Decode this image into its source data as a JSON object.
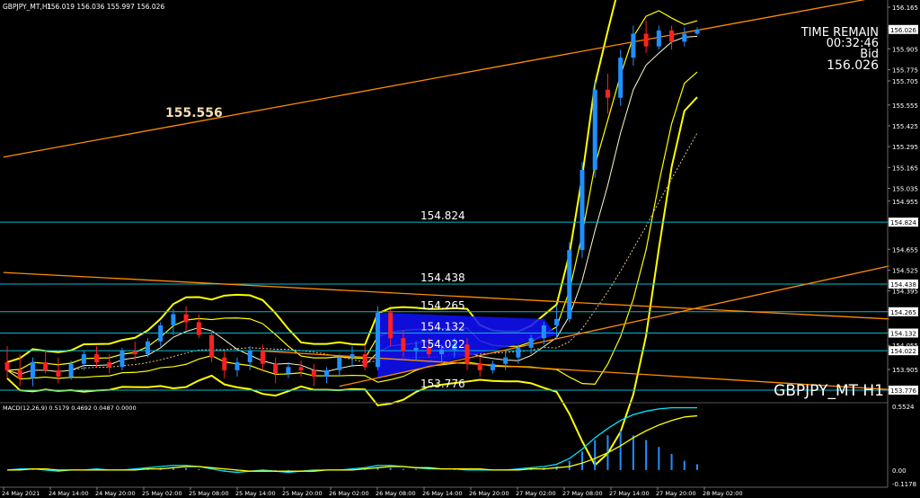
{
  "header": {
    "symbol_info": "GBPJPY_MT,H1",
    "ohlc": "156.019 156.036 155.997 156.026"
  },
  "overlay": {
    "time_remain_label": "TIME REMAIN",
    "time_remain_value": "00:32:46",
    "bid_label": "Bid",
    "bid_value": "156.026",
    "level_label": "155.556",
    "watermark": "GBPJPY_MT H1"
  },
  "macd": {
    "label": "MACD(12,26,9) 0.5179 0.4692 0.0487 0.0000",
    "scale": [
      "0.5524",
      "0.00",
      "-0.1178"
    ]
  },
  "colors": {
    "background": "#000000",
    "bull_candle": "#1e90ff",
    "bear_candle": "#ff2020",
    "bollinger": "#ffff00",
    "trendline": "#ff8c00",
    "hline": "#00bcd4",
    "price_tag_bg": "#00bcd4",
    "grid": "#202020"
  },
  "chart_data": {
    "type": "candlestick",
    "title": "GBPJPY_MT H1",
    "ylim": [
      153.776,
      156.2
    ],
    "yticks": [
      "156.165",
      "156.035",
      "155.905",
      "155.775",
      "155.705",
      "155.555",
      "155.425",
      "155.295",
      "155.165",
      "155.035",
      "154.955",
      "154.825",
      "154.655",
      "154.525",
      "154.395",
      "154.265",
      "154.135",
      "154.055",
      "153.905",
      "153.775"
    ],
    "xticks": [
      "24 May 2021",
      "24 May 14:00",
      "24 May 20:00",
      "25 May 02:00",
      "25 May 08:00",
      "25 May 14:00",
      "25 May 20:00",
      "26 May 02:00",
      "26 May 08:00",
      "26 May 14:00",
      "26 May 20:00",
      "27 May 02:00",
      "27 May 08:00",
      "27 May 14:00",
      "27 May 20:00",
      "28 May 02:00"
    ],
    "price_tags": [
      {
        "label": "156.026",
        "value": 156.026
      },
      {
        "label": "154.824",
        "value": 154.824
      },
      {
        "label": "154.438",
        "value": 154.438
      },
      {
        "label": "154.265",
        "value": 154.265
      },
      {
        "label": "154.132",
        "value": 154.132
      },
      {
        "label": "154.022",
        "value": 154.022
      },
      {
        "label": "153.776",
        "value": 153.776
      }
    ],
    "levels": [
      {
        "label": "154.824",
        "value": 154.824
      },
      {
        "label": "154.438",
        "value": 154.438
      },
      {
        "label": "154.265",
        "value": 154.265
      },
      {
        "label": "154.132",
        "value": 154.132
      },
      {
        "label": "154.022",
        "value": 154.022
      },
      {
        "label": "153.776",
        "value": 153.776
      }
    ],
    "candles": [
      [
        153.95,
        154.05,
        153.85,
        153.9
      ],
      [
        153.9,
        154.0,
        153.8,
        153.85
      ],
      [
        153.85,
        153.98,
        153.8,
        153.95
      ],
      [
        153.95,
        154.02,
        153.88,
        153.9
      ],
      [
        153.9,
        153.98,
        153.82,
        153.86
      ],
      [
        153.86,
        153.96,
        153.84,
        153.94
      ],
      [
        153.94,
        154.02,
        153.9,
        154.0
      ],
      [
        154.0,
        154.05,
        153.92,
        153.95
      ],
      [
        153.95,
        154.0,
        153.88,
        153.92
      ],
      [
        153.92,
        154.04,
        153.9,
        154.02
      ],
      [
        154.02,
        154.08,
        153.96,
        154.0
      ],
      [
        154.0,
        154.1,
        153.98,
        154.08
      ],
      [
        154.08,
        154.2,
        154.05,
        154.18
      ],
      [
        154.18,
        154.28,
        154.12,
        154.25
      ],
      [
        154.25,
        154.3,
        154.15,
        154.2
      ],
      [
        154.2,
        154.25,
        154.1,
        154.12
      ],
      [
        154.12,
        154.15,
        153.95,
        153.98
      ],
      [
        153.98,
        154.02,
        153.85,
        153.9
      ],
      [
        153.9,
        153.98,
        153.86,
        153.95
      ],
      [
        153.95,
        154.05,
        153.9,
        154.02
      ],
      [
        154.02,
        154.06,
        153.9,
        153.94
      ],
      [
        153.94,
        153.98,
        153.82,
        153.88
      ],
      [
        153.88,
        153.95,
        153.85,
        153.92
      ],
      [
        153.92,
        153.96,
        153.86,
        153.9
      ],
      [
        153.9,
        153.94,
        153.8,
        153.86
      ],
      [
        153.86,
        153.92,
        153.82,
        153.9
      ],
      [
        153.9,
        154.0,
        153.86,
        153.98
      ],
      [
        153.98,
        154.05,
        153.92,
        154.0
      ],
      [
        154.0,
        154.06,
        153.9,
        153.92
      ],
      [
        153.92,
        154.3,
        153.9,
        154.26
      ],
      [
        154.26,
        154.28,
        154.05,
        154.1
      ],
      [
        154.1,
        154.15,
        153.98,
        154.02
      ],
      [
        154.02,
        154.08,
        153.96,
        154.04
      ],
      [
        154.04,
        154.1,
        153.98,
        154.0
      ],
      [
        154.0,
        154.06,
        153.95,
        154.03
      ],
      [
        154.03,
        154.1,
        153.98,
        154.06
      ],
      [
        154.06,
        154.1,
        153.9,
        153.94
      ],
      [
        153.94,
        153.98,
        153.86,
        153.9
      ],
      [
        153.9,
        153.96,
        153.88,
        153.94
      ],
      [
        153.94,
        154.02,
        153.9,
        153.98
      ],
      [
        153.98,
        154.06,
        153.94,
        154.04
      ],
      [
        154.04,
        154.12,
        154.0,
        154.1
      ],
      [
        154.1,
        154.2,
        154.06,
        154.18
      ],
      [
        154.18,
        154.3,
        154.1,
        154.22
      ],
      [
        154.22,
        154.7,
        154.2,
        154.65
      ],
      [
        154.65,
        155.2,
        154.6,
        155.15
      ],
      [
        155.15,
        155.7,
        155.1,
        155.65
      ],
      [
        155.65,
        155.75,
        155.5,
        155.6
      ],
      [
        155.6,
        155.9,
        155.55,
        155.85
      ],
      [
        155.85,
        156.05,
        155.8,
        156.0
      ],
      [
        156.0,
        156.08,
        155.88,
        155.92
      ],
      [
        155.92,
        156.05,
        155.9,
        156.02
      ],
      [
        156.02,
        156.05,
        155.9,
        155.95
      ],
      [
        155.95,
        156.04,
        155.92,
        156.0
      ],
      [
        156.0,
        156.04,
        155.99,
        156.026
      ]
    ],
    "macd": {
      "ylim": [
        -0.1178,
        0.5524
      ],
      "histogram": [
        0.0,
        0.01,
        0.01,
        0.0,
        -0.01,
        0.0,
        0.0,
        0.01,
        0.0,
        0.0,
        0.01,
        0.01,
        0.02,
        0.02,
        0.02,
        0.01,
        0.0,
        -0.01,
        -0.01,
        0.0,
        0.0,
        -0.01,
        -0.01,
        0.0,
        0.0,
        0.0,
        0.0,
        0.01,
        0.01,
        0.02,
        0.02,
        0.01,
        0.01,
        0.0,
        0.0,
        0.01,
        0.0,
        0.0,
        0.0,
        0.0,
        0.01,
        0.01,
        0.02,
        0.03,
        0.08,
        0.16,
        0.26,
        0.3,
        0.34,
        0.3,
        0.26,
        0.2,
        0.14,
        0.08,
        0.05
      ],
      "main": [
        0.0,
        0.01,
        0.01,
        0.0,
        -0.01,
        0.0,
        0.0,
        0.01,
        0.0,
        0.0,
        0.01,
        0.02,
        0.03,
        0.04,
        0.04,
        0.03,
        0.01,
        -0.01,
        -0.02,
        -0.01,
        0.0,
        -0.01,
        -0.02,
        -0.01,
        0.0,
        0.0,
        0.0,
        0.01,
        0.02,
        0.04,
        0.04,
        0.03,
        0.02,
        0.01,
        0.01,
        0.01,
        0.0,
        0.0,
        0.0,
        0.0,
        0.01,
        0.02,
        0.03,
        0.05,
        0.1,
        0.18,
        0.28,
        0.36,
        0.43,
        0.48,
        0.51,
        0.53,
        0.54,
        0.54,
        0.54
      ],
      "signal": [
        0.0,
        0.0,
        0.01,
        0.01,
        0.0,
        0.0,
        0.0,
        0.0,
        0.0,
        0.0,
        0.0,
        0.01,
        0.01,
        0.02,
        0.03,
        0.03,
        0.02,
        0.01,
        0.0,
        -0.01,
        -0.01,
        -0.01,
        -0.01,
        -0.01,
        -0.01,
        0.0,
        0.0,
        0.0,
        0.01,
        0.02,
        0.03,
        0.03,
        0.02,
        0.02,
        0.01,
        0.01,
        0.01,
        0.01,
        0.0,
        0.0,
        0.0,
        0.01,
        0.01,
        0.02,
        0.03,
        0.06,
        0.1,
        0.15,
        0.21,
        0.28,
        0.34,
        0.39,
        0.43,
        0.46,
        0.47
      ]
    }
  }
}
